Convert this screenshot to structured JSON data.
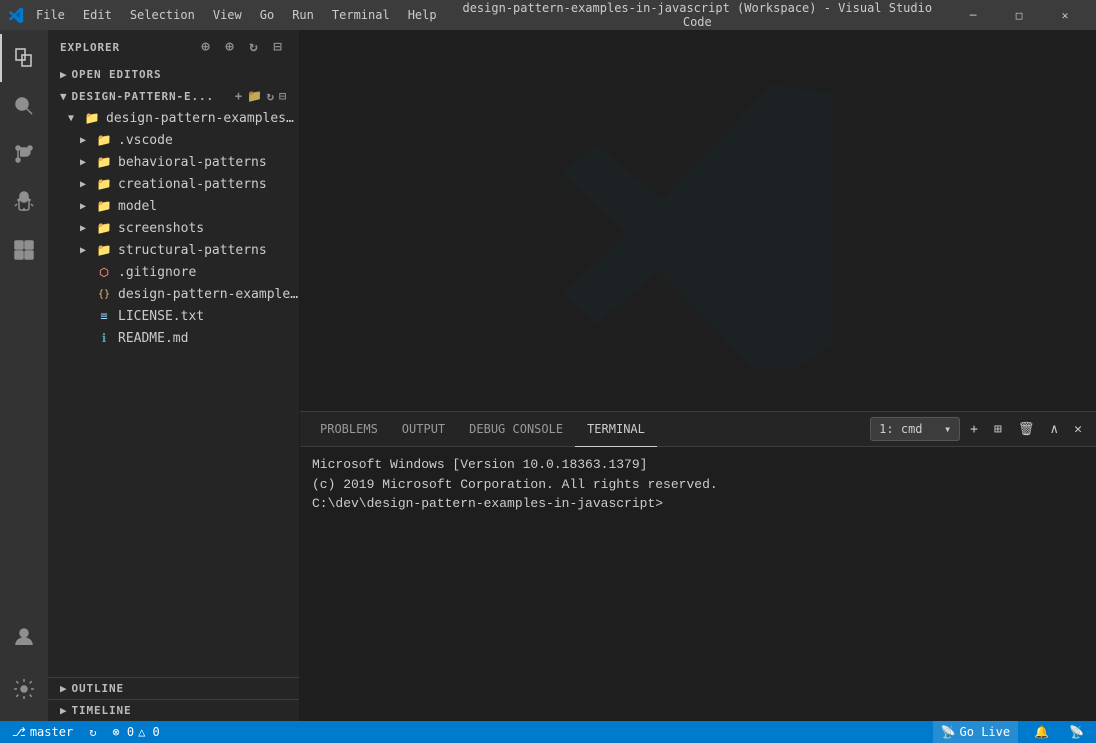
{
  "titleBar": {
    "title": "design-pattern-examples-in-javascript (Workspace) - Visual Studio Code",
    "menu": [
      "File",
      "Edit",
      "Selection",
      "View",
      "Go",
      "Run",
      "Terminal",
      "Help"
    ],
    "winButtons": [
      "−",
      "□",
      "×"
    ]
  },
  "sidebar": {
    "header": "EXPLORER",
    "sections": {
      "openEditors": "OPEN EDITORS",
      "workspace": "DESIGN-PATTERN-E..."
    },
    "rootFolder": "design-pattern-examples-in-javascr...",
    "items": [
      {
        "label": ".vscode",
        "type": "folder",
        "indent": 2
      },
      {
        "label": "behavioral-patterns",
        "type": "folder",
        "indent": 2
      },
      {
        "label": "creational-patterns",
        "type": "folder",
        "indent": 2
      },
      {
        "label": "model",
        "type": "folder",
        "indent": 2
      },
      {
        "label": "screenshots",
        "type": "folder",
        "indent": 2
      },
      {
        "label": "structural-patterns",
        "type": "folder",
        "indent": 2
      },
      {
        "label": ".gitignore",
        "type": "git",
        "indent": 2
      },
      {
        "label": "design-pattern-examples-in-javas...",
        "type": "json",
        "indent": 2
      },
      {
        "label": "LICENSE.txt",
        "type": "license",
        "indent": 2
      },
      {
        "label": "README.md",
        "type": "readme",
        "indent": 2
      }
    ],
    "outline": "OUTLINE",
    "timeline": "TIMELINE"
  },
  "terminal": {
    "tabs": [
      "PROBLEMS",
      "OUTPUT",
      "DEBUG CONSOLE",
      "TERMINAL"
    ],
    "activeTab": "TERMINAL",
    "dropdown": "1: cmd",
    "line1": "Microsoft Windows [Version 10.0.18363.1379]",
    "line2": "(c) 2019 Microsoft Corporation. All rights reserved.",
    "prompt": "C:\\dev\\design-pattern-examples-in-javascript>"
  },
  "statusBar": {
    "branch": "master",
    "sync": "↻",
    "errors": "⊗ 0",
    "warnings": "△ 0",
    "goLive": "Go Live",
    "notifications": "🔔",
    "broadcast": "📡"
  },
  "icons": {
    "explorer": "explorer-icon",
    "search": "search-icon",
    "git": "source-control-icon",
    "debug": "debug-icon",
    "extensions": "extensions-icon",
    "account": "account-icon",
    "settings": "settings-icon"
  }
}
